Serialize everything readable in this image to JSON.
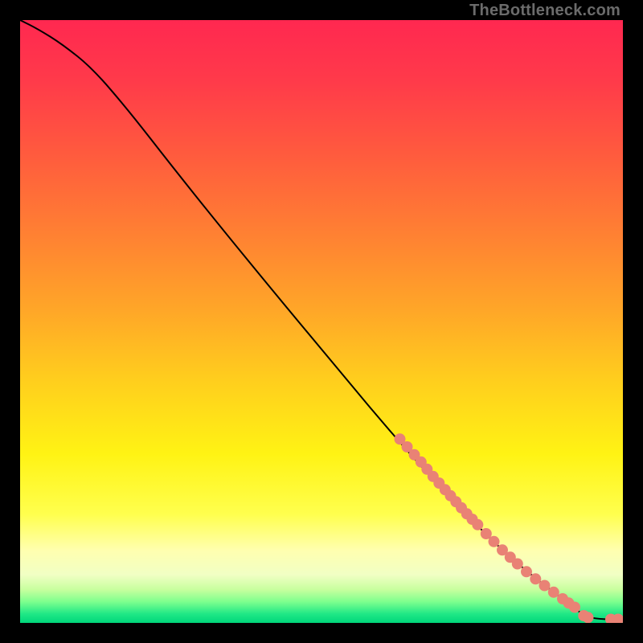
{
  "watermark": "TheBottleneck.com",
  "chart_data": {
    "type": "line",
    "title": "",
    "xlabel": "",
    "ylabel": "",
    "xlim": [
      0,
      100
    ],
    "ylim": [
      0,
      100
    ],
    "curve": {
      "name": "bottleneck-curve",
      "x": [
        0,
        3,
        7,
        12,
        18,
        25,
        33,
        42,
        52,
        62,
        72,
        80,
        86,
        90,
        93.5,
        96,
        100
      ],
      "y": [
        100,
        98.5,
        96,
        92,
        85,
        76,
        66,
        55,
        43,
        31,
        20,
        12,
        7,
        4,
        1.2,
        0.6,
        0.6
      ]
    },
    "points": {
      "name": "highlighted-markers",
      "color": "#e98275",
      "xy": [
        [
          63,
          30.5
        ],
        [
          64.2,
          29.2
        ],
        [
          65.4,
          27.9
        ],
        [
          66.5,
          26.7
        ],
        [
          67.5,
          25.5
        ],
        [
          68.5,
          24.3
        ],
        [
          69.5,
          23.2
        ],
        [
          70.5,
          22.1
        ],
        [
          71.4,
          21.1
        ],
        [
          72.3,
          20.1
        ],
        [
          73.2,
          19.1
        ],
        [
          74.1,
          18.1
        ],
        [
          75,
          17.2
        ],
        [
          75.9,
          16.3
        ],
        [
          77.3,
          14.8
        ],
        [
          78.6,
          13.5
        ],
        [
          80,
          12.1
        ],
        [
          81.3,
          10.9
        ],
        [
          82.5,
          9.8
        ],
        [
          84,
          8.5
        ],
        [
          85.5,
          7.3
        ],
        [
          87,
          6.2
        ],
        [
          88.5,
          5.1
        ],
        [
          90,
          4
        ],
        [
          91,
          3.3
        ],
        [
          92,
          2.6
        ],
        [
          93.5,
          1.2
        ],
        [
          94.2,
          0.9
        ],
        [
          98,
          0.6
        ],
        [
          99.2,
          0.6
        ]
      ]
    },
    "background_gradient_stops": [
      {
        "offset": 0,
        "color": "#ff2850"
      },
      {
        "offset": 0.1,
        "color": "#ff3a4a"
      },
      {
        "offset": 0.22,
        "color": "#ff5a3e"
      },
      {
        "offset": 0.35,
        "color": "#ff7f33"
      },
      {
        "offset": 0.48,
        "color": "#ffa628"
      },
      {
        "offset": 0.6,
        "color": "#ffcf1d"
      },
      {
        "offset": 0.72,
        "color": "#fff314"
      },
      {
        "offset": 0.82,
        "color": "#ffff4e"
      },
      {
        "offset": 0.88,
        "color": "#ffffb0"
      },
      {
        "offset": 0.92,
        "color": "#f1ffc4"
      },
      {
        "offset": 0.945,
        "color": "#c7ff9e"
      },
      {
        "offset": 0.965,
        "color": "#7dff8e"
      },
      {
        "offset": 0.985,
        "color": "#20e886"
      },
      {
        "offset": 1.0,
        "color": "#00d67a"
      }
    ]
  }
}
